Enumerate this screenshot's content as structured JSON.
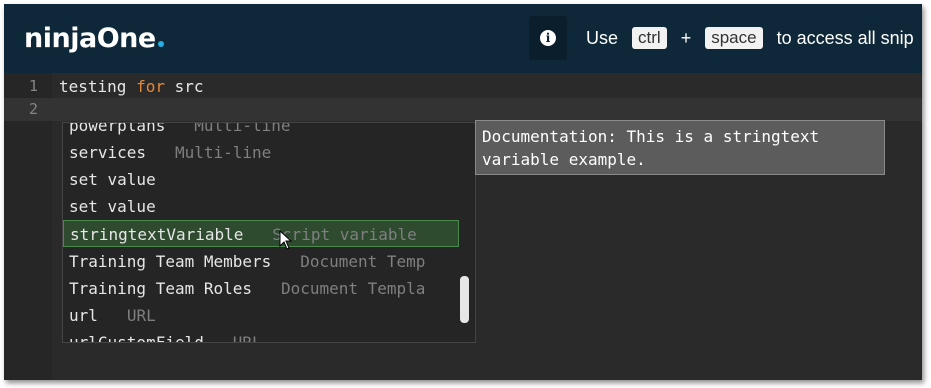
{
  "header": {
    "logo_ninja": "ninja",
    "logo_one": "One",
    "hint_use": "Use",
    "hint_key1": "ctrl",
    "hint_plus": "+",
    "hint_key2": "space",
    "hint_rest": "to access all snip"
  },
  "editor": {
    "lines": [
      {
        "number": "1",
        "text": "testing ",
        "keyword": "for",
        "rest": " src"
      },
      {
        "number": "2",
        "text": ""
      }
    ]
  },
  "suggestions": [
    {
      "label": "powerplans",
      "detail": "Multi-line"
    },
    {
      "label": "services",
      "detail": "Multi-line"
    },
    {
      "label": "set value",
      "detail": ""
    },
    {
      "label": "set value",
      "detail": ""
    },
    {
      "label": "stringtextVariable",
      "detail": "Script variable"
    },
    {
      "label": "Training Team Members",
      "detail": "Document Temp"
    },
    {
      "label": "Training Team Roles",
      "detail": "Document Templa"
    },
    {
      "label": "url",
      "detail": "URL"
    },
    {
      "label": "urlCustomField",
      "detail": "URL"
    }
  ],
  "selected_index": 4,
  "documentation": "Documentation: This is a stringtext variable example.",
  "icons": {
    "info": "info-icon",
    "cursor": "mouse-pointer-icon"
  }
}
